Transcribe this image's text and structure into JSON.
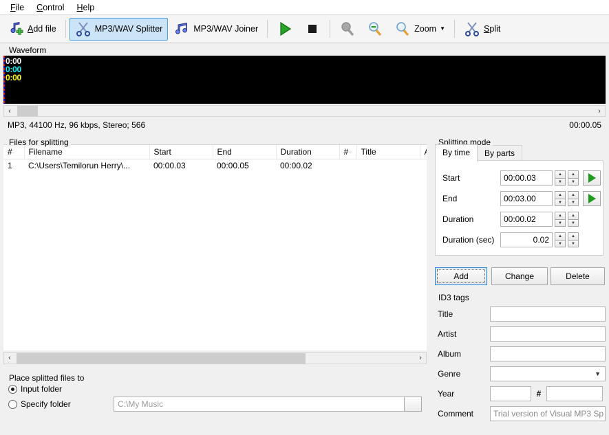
{
  "menu": {
    "items": [
      {
        "name": "file",
        "accel": "F",
        "rest": "ile"
      },
      {
        "name": "control",
        "accel": "C",
        "rest": "ontrol"
      },
      {
        "name": "help",
        "accel": "H",
        "rest": "elp"
      }
    ]
  },
  "toolbar": {
    "add_file": {
      "accel": "A",
      "rest": "dd file",
      "icon": "music-note-plus-icon"
    },
    "splitter_tab": {
      "label": "MP3/WAV Splitter",
      "icon": "scissors-icon",
      "selected": true
    },
    "joiner_tab": {
      "label": "MP3/WAV Joiner",
      "icon": "music-notes-icon",
      "selected": false
    },
    "play": {
      "icon": "play-icon"
    },
    "stop": {
      "icon": "stop-icon"
    },
    "zoom_reset": {
      "icon": "magnifier-icon"
    },
    "zoom_out": {
      "icon": "magnifier-minus-icon"
    },
    "zoom_in": {
      "icon": "magnifier-plus-icon"
    },
    "zoom_menu": {
      "label": "Zoom",
      "icon": "chevron-down-icon"
    },
    "split": {
      "accel": "S",
      "rest": "plit",
      "icon": "scissors-icon"
    }
  },
  "waveform": {
    "title": "Waveform",
    "time_white": "0:00",
    "time_cyan": "0:00",
    "time_yellow": "0:00",
    "colors": {
      "white": "#ffffff",
      "cyan": "#00ffff",
      "yellow": "#ffff00",
      "background": "#000000"
    },
    "status_left": "MP3, 44100 Hz, 96 kbps, Stereo; 566",
    "status_right": "00:00.05",
    "scroll_left_arrow": "‹",
    "scroll_right_arrow": "›"
  },
  "files": {
    "title": "Files for splitting",
    "columns": [
      "#",
      "Filename",
      "Start",
      "End",
      "Duration",
      "#",
      "Title",
      "Artis"
    ],
    "rows": [
      {
        "index": "1",
        "filename": "C:\\Users\\Temilorun Herry\\...",
        "start": "00:00.03",
        "end": "00:00.05",
        "duration": "00:00.02",
        "track": "",
        "title": "",
        "artist": ""
      }
    ],
    "scroll_left_arrow": "‹",
    "scroll_right_arrow": "›"
  },
  "place": {
    "title": "Place splitted files to",
    "input_folder_label": "Input folder",
    "specify_folder_label": "Specify folder",
    "selected": "input_folder",
    "folder_placeholder": "C:\\My Music",
    "browse_label": ""
  },
  "splitting": {
    "title": "Splitting mode",
    "tabs": [
      {
        "label": "By time",
        "selected": true
      },
      {
        "label": "By parts",
        "selected": false
      }
    ],
    "fields": [
      {
        "label": "Start",
        "value": "00:00.03",
        "align": "left",
        "play": true
      },
      {
        "label": "End",
        "value": "00:03.00",
        "align": "left",
        "play": true
      },
      {
        "label": "Duration",
        "value": "00:00.02",
        "align": "left",
        "play": false
      },
      {
        "label": "Duration (sec)",
        "value": "0.02",
        "align": "right",
        "play": false
      }
    ],
    "spin_up": "▲",
    "spin_down": "▼"
  },
  "actions": {
    "add": "Add",
    "change": "Change",
    "delete": "Delete",
    "focused": "add"
  },
  "id3": {
    "title": "ID3 tags",
    "title_label": "Title",
    "title_value": "",
    "artist_label": "Artist",
    "artist_value": "",
    "album_label": "Album",
    "album_value": "",
    "genre_label": "Genre",
    "genre_value": "",
    "year_label": "Year",
    "year_value": "",
    "hash_label": "#",
    "track_value": "",
    "comment_label": "Comment",
    "comment_placeholder": "Trial version of Visual MP3 Sp"
  }
}
